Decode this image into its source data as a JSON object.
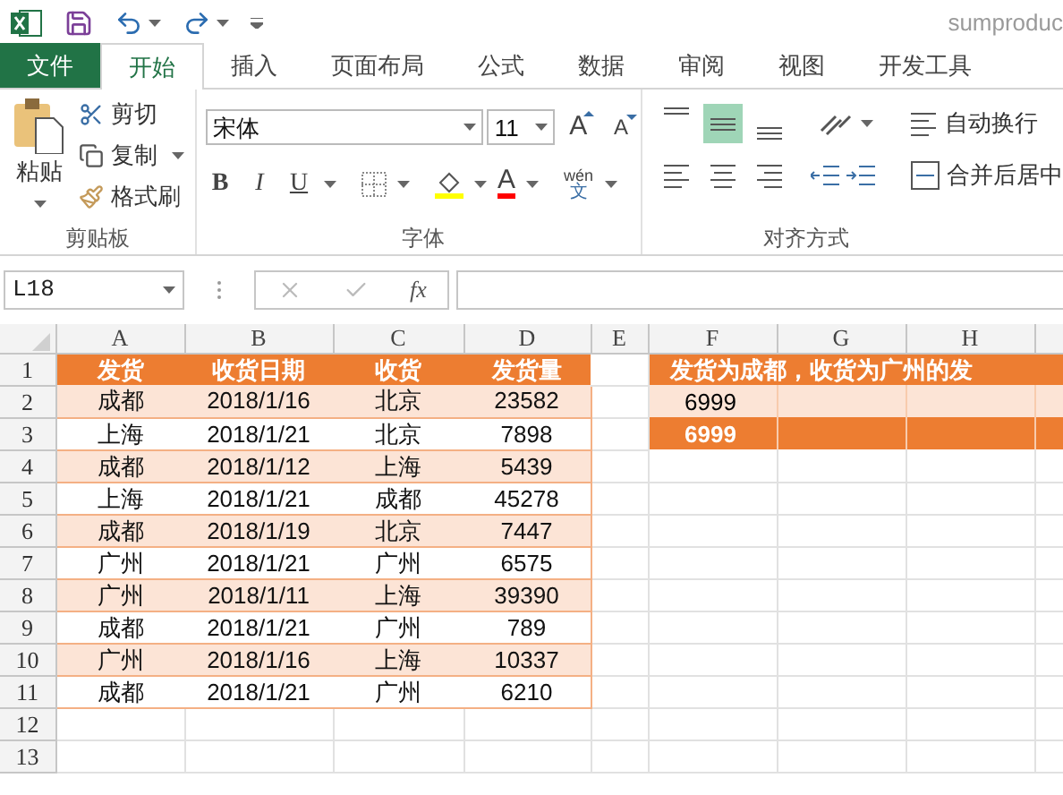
{
  "title_bar": {
    "title": "sumproduc"
  },
  "ribbon_tabs": [
    {
      "label": "文件",
      "kind": "file",
      "selected": false
    },
    {
      "label": "开始",
      "kind": "tab",
      "selected": true
    },
    {
      "label": "插入",
      "kind": "tab",
      "selected": false
    },
    {
      "label": "页面布局",
      "kind": "tab",
      "selected": false
    },
    {
      "label": "公式",
      "kind": "tab",
      "selected": false
    },
    {
      "label": "数据",
      "kind": "tab",
      "selected": false
    },
    {
      "label": "审阅",
      "kind": "tab",
      "selected": false
    },
    {
      "label": "视图",
      "kind": "tab",
      "selected": false
    },
    {
      "label": "开发工具",
      "kind": "tab",
      "selected": false
    }
  ],
  "clipboard": {
    "paste": "粘贴",
    "cut": "剪切",
    "copy": "复制",
    "format_painter": "格式刷",
    "group_label": "剪贴板"
  },
  "font": {
    "name": "宋体",
    "size": "11",
    "size_buttons": [
      {
        "label": "A",
        "kind": "grow"
      },
      {
        "label": "A",
        "kind": "shrink"
      }
    ],
    "style_buttons": [
      {
        "label": "B",
        "kind": "bold"
      },
      {
        "label": "I",
        "kind": "italic"
      },
      {
        "label": "U",
        "kind": "underline"
      }
    ],
    "font_color": "A",
    "phonetic": "wén",
    "phonetic_char": "文",
    "group_label": "字体"
  },
  "alignment": {
    "vertical": [
      {
        "kind": "top",
        "selected": false
      },
      {
        "kind": "middle",
        "selected": true
      },
      {
        "kind": "bottom",
        "selected": false
      }
    ],
    "wrap_text": "自动换行",
    "merge_center": "合并后居中",
    "group_label": "对齐方式"
  },
  "formula_bar": {
    "name_box": "L18",
    "function_symbol": "fx"
  },
  "sheet": {
    "columns": [
      "A",
      "B",
      "C",
      "D",
      "E",
      "F",
      "G",
      "H"
    ],
    "row_numbers": [
      "1",
      "2",
      "3",
      "4",
      "5",
      "6",
      "7",
      "8",
      "9",
      "10",
      "11",
      "12",
      "13"
    ],
    "table": {
      "columns": [
        "发货",
        "收货日期",
        "收货",
        "发货量"
      ],
      "rows": [
        {
          "cells": [
            "成都",
            "2018/1/16",
            "北京",
            "23582"
          ],
          "banded": true
        },
        {
          "cells": [
            "上海",
            "2018/1/21",
            "北京",
            "7898"
          ],
          "banded": false
        },
        {
          "cells": [
            "成都",
            "2018/1/12",
            "上海",
            "5439"
          ],
          "banded": true
        },
        {
          "cells": [
            "上海",
            "2018/1/21",
            "成都",
            "45278"
          ],
          "banded": false
        },
        {
          "cells": [
            "成都",
            "2018/1/19",
            "北京",
            "7447"
          ],
          "banded": true
        },
        {
          "cells": [
            "广州",
            "2018/1/21",
            "广州",
            "6575"
          ],
          "banded": false
        },
        {
          "cells": [
            "广州",
            "2018/1/11",
            "上海",
            "39390"
          ],
          "banded": true
        },
        {
          "cells": [
            "成都",
            "2018/1/21",
            "广州",
            "789"
          ],
          "banded": false
        },
        {
          "cells": [
            "广州",
            "2018/1/16",
            "上海",
            "10337"
          ],
          "banded": true
        },
        {
          "cells": [
            "成都",
            "2018/1/21",
            "广州",
            "6210"
          ],
          "banded": false
        }
      ]
    },
    "summary": {
      "title": "发货为成都，收货为广州的发",
      "results": [
        {
          "value": "6999",
          "kind": "plain"
        },
        {
          "value": "6999",
          "kind": "highlight"
        }
      ]
    }
  }
}
